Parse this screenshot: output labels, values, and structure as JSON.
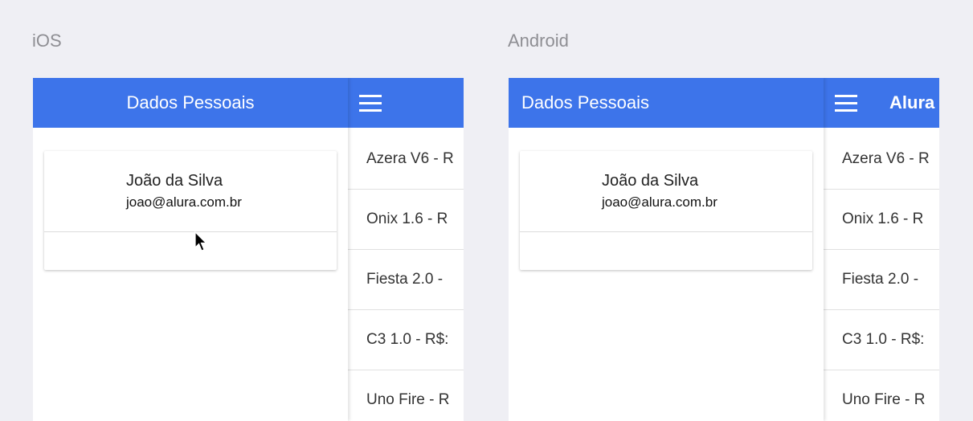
{
  "platforms": [
    {
      "label": "iOS",
      "menu_header": "Dados Pessoais",
      "menu_align": "center",
      "main_title": "",
      "user": {
        "name": "João da Silva",
        "email": "joao@alura.com.br"
      },
      "cars": [
        "Azera V6 - R",
        "Onix 1.6 - R",
        "Fiesta 2.0 -",
        "C3 1.0 - R$:",
        "Uno Fire - R"
      ]
    },
    {
      "label": "Android",
      "menu_header": "Dados Pessoais",
      "menu_align": "left",
      "main_title": "Alura",
      "user": {
        "name": "João da Silva",
        "email": "joao@alura.com.br"
      },
      "cars": [
        "Azera V6 - R",
        "Onix 1.6 - R",
        "Fiesta 2.0 -",
        "C3 1.0 - R$:",
        "Uno Fire - R"
      ]
    }
  ],
  "colors": {
    "header": "#3d74ea",
    "background": "#efeff4"
  }
}
